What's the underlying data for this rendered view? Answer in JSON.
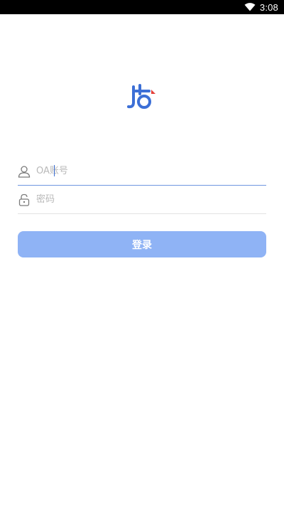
{
  "status_bar": {
    "time": "3:08"
  },
  "login_form": {
    "account_placeholder": "OA账号",
    "account_value": "",
    "password_placeholder": "密码",
    "password_value": "",
    "submit_label": "登录"
  },
  "colors": {
    "accent": "#3c6fd6",
    "button": "#8fb3f5",
    "logo_red": "#e4403a"
  },
  "icons": [
    "wifi-icon",
    "app-logo",
    "user-icon",
    "lock-icon"
  ]
}
